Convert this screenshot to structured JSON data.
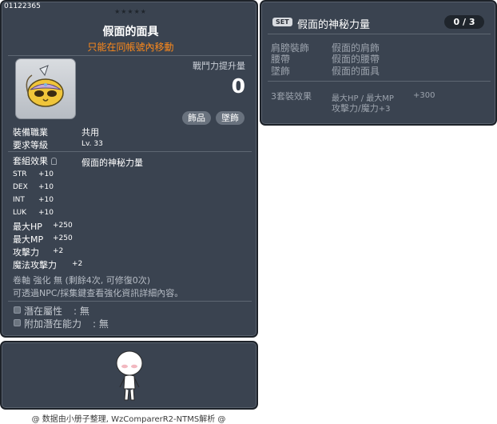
{
  "item": {
    "id": "01122365",
    "stars": "★★★★★",
    "name": "假面的面具",
    "subtitle": "只能在同帳號內移動",
    "power_label": "戰鬥力提升量",
    "power_value": "0",
    "tags": [
      "飾品",
      "墜飾"
    ],
    "job_label": "裝備職業",
    "job_value": "共用",
    "level_label": "要求等級",
    "level_value": "Lv. 33",
    "set_label": "套組效果",
    "set_name": "假面的神秘力量",
    "stats": [
      {
        "label": "STR",
        "value": "+10"
      },
      {
        "label": "DEX",
        "value": "+10"
      },
      {
        "label": "INT",
        "value": "+10"
      },
      {
        "label": "LUK",
        "value": "+10"
      },
      {
        "label": "最大HP",
        "value": "+250"
      },
      {
        "label": "最大MP",
        "value": "+250"
      },
      {
        "label": "攻擊力",
        "value": "+2"
      },
      {
        "label": "魔法攻擊力",
        "value": "+2"
      }
    ],
    "scroll_text": "卷軸 強化 無 (剩餘4次, 可修復0次)",
    "npc_text": "可透過NPC/採集鍵查看強化資訊詳細內容。",
    "potential": [
      {
        "label": "潛在屬性",
        "value": ": 無"
      },
      {
        "label": "附加潛在能力",
        "value": ": 無"
      }
    ]
  },
  "set": {
    "badge": "SET",
    "title": "假面的神秘力量",
    "count": "0 / 3",
    "items": [
      {
        "slot": "肩膀裝飾",
        "name": "假面的肩飾"
      },
      {
        "slot": "腰帶",
        "name": "假面的腰帶"
      },
      {
        "slot": "墜飾",
        "name": "假面的面具"
      }
    ],
    "effect_label": "3套裝效果",
    "effects": [
      {
        "label": "最大HP / 最大MP",
        "value": "+300"
      },
      {
        "label": "攻擊力/魔力",
        "value": "+3"
      }
    ]
  },
  "footer": "@ 数据由小册子整理, WzComparerR2-NTMS解析 @"
}
